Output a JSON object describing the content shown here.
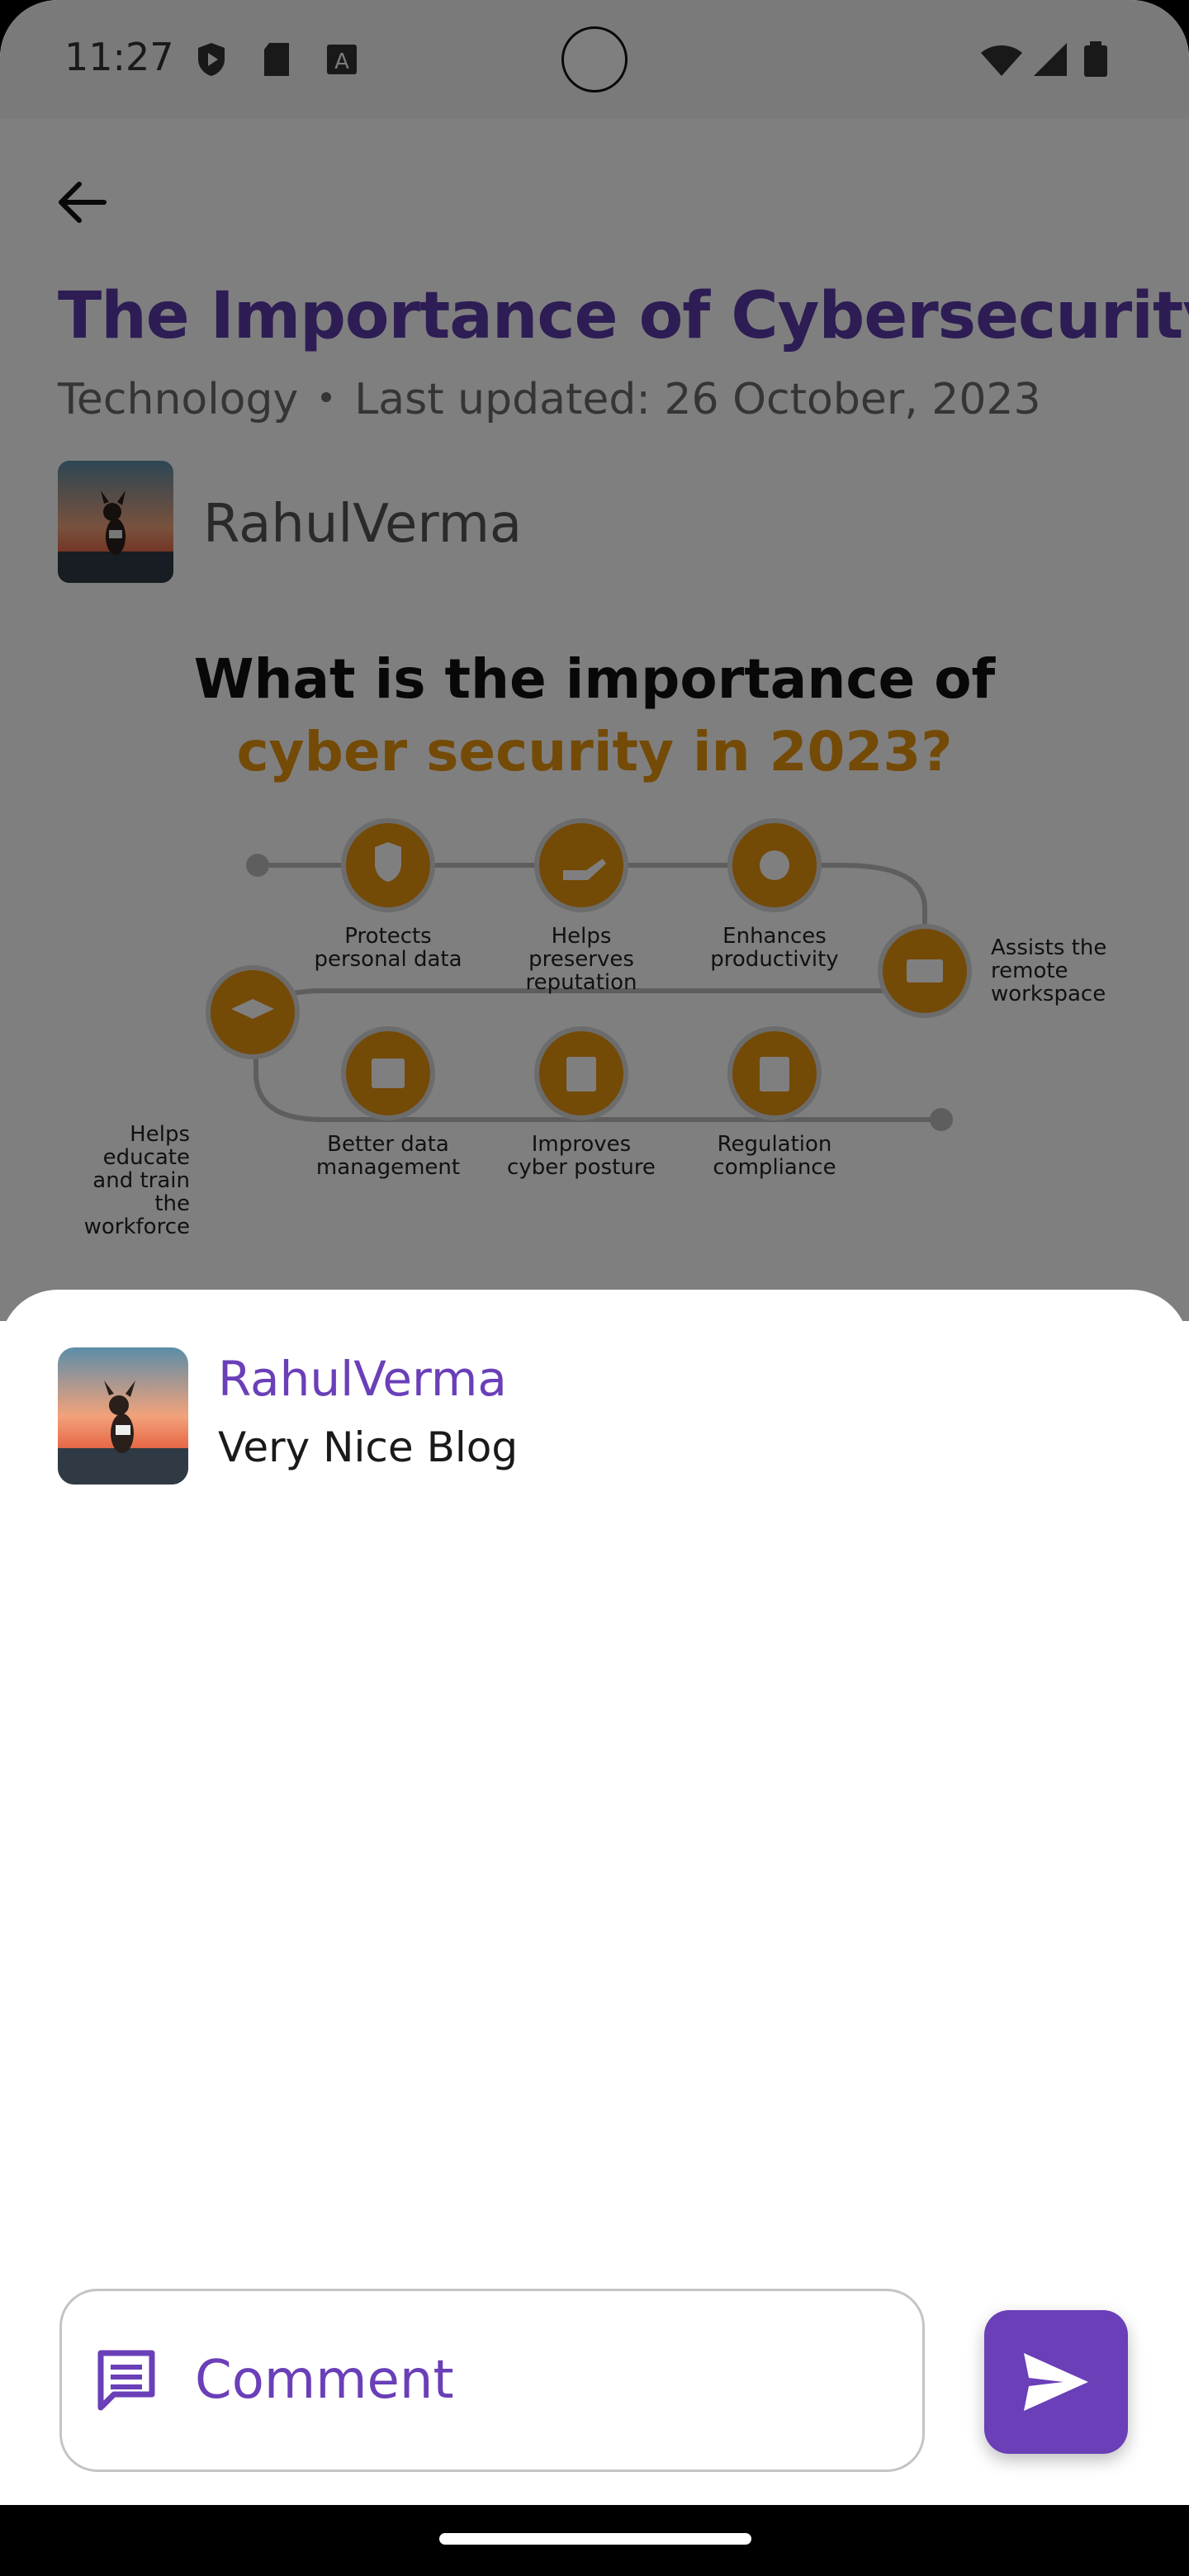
{
  "status_bar": {
    "time": "11:27"
  },
  "article": {
    "title": "The Importance of Cybersecurity",
    "category": "Technology",
    "last_updated": "Last updated: 26 October, 2023",
    "author": "RahulVerma",
    "infographic": {
      "title_line1": "What is the importance of",
      "title_line2": "cyber security in 2023?",
      "labels": {
        "protects": "Protects personal data",
        "reputation": "Helps preserves reputation",
        "productivity": "Enhances productivity",
        "remote": "Assists the remote workspace",
        "data_mgmt": "Better data management",
        "posture": "Improves cyber posture",
        "compliance": "Regulation compliance",
        "educate": "Helps educate and train the workforce"
      },
      "colors": {
        "accent": "#e8940f",
        "title": "#111111"
      }
    }
  },
  "comments": [
    {
      "author": "RahulVerma",
      "text": "Very Nice Blog"
    }
  ],
  "comment_input": {
    "placeholder": "Comment",
    "value": ""
  },
  "colors": {
    "primary": "#6a3fb8",
    "scrim": "rgba(0,0,0,0.5)"
  },
  "icons": {
    "back": "arrow-left-icon",
    "comment": "comment-icon",
    "send": "send-icon"
  }
}
